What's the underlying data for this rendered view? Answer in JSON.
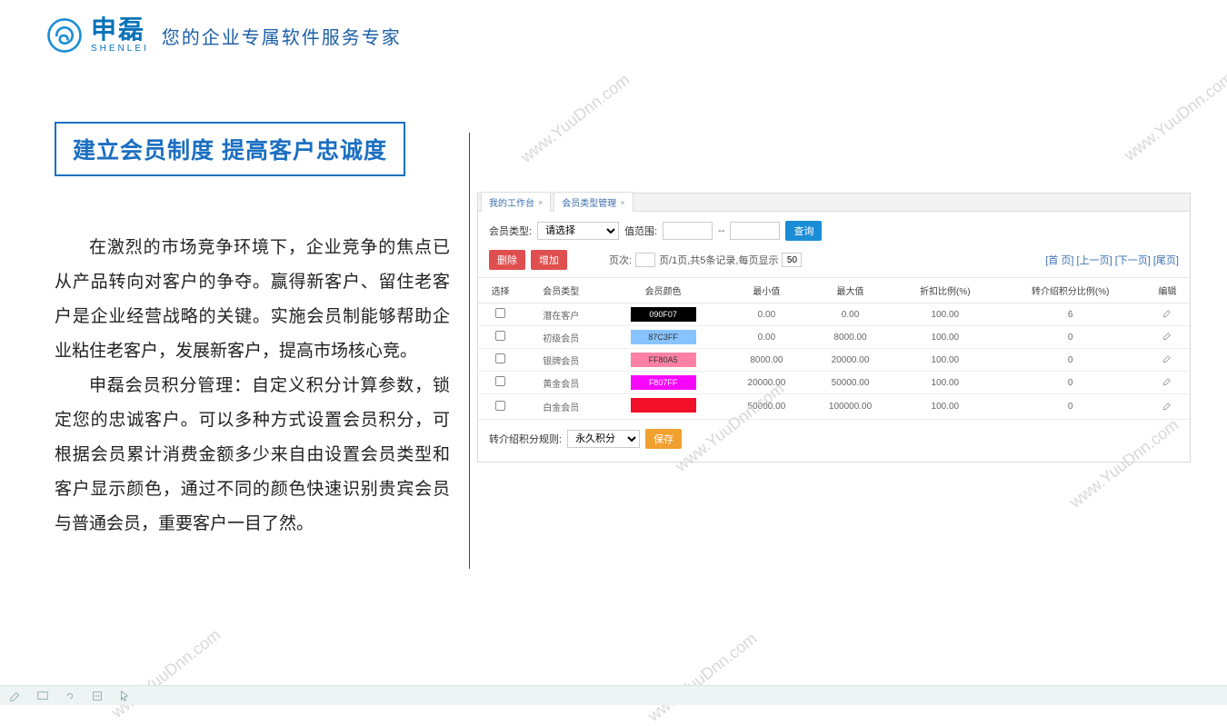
{
  "header": {
    "brand_cn": "申磊",
    "brand_en": "SHENLEI",
    "tagline": "您的企业专属软件服务专家"
  },
  "headline": "建立会员制度 提高客户忠诚度",
  "paragraphs": [
    "在激烈的市场竞争环境下，企业竞争的焦点已从产品转向对客户的争夺。赢得新客户、留住老客户是企业经营战略的关键。实施会员制能够帮助企业粘住老客户，发展新客户，提高市场核心竞。",
    "申磊会员积分管理：自定义积分计算参数，锁定您的忠诚客户。可以多种方式设置会员积分，可根据会员累计消费金额多少来自由设置会员类型和客户显示颜色，通过不同的颜色快速识别贵宾会员与普通会员，重要客户一目了然。"
  ],
  "app": {
    "tabs": [
      {
        "label": "我的工作台"
      },
      {
        "label": "会员类型管理"
      }
    ],
    "filters": {
      "type_label": "会员类型:",
      "type_placeholder": "请选择",
      "range_label": "值范围:",
      "range_sep": "--",
      "query_btn": "查询",
      "delete_btn": "删除",
      "add_btn": "增加"
    },
    "pager": {
      "prefix": "页次:",
      "page_input": "",
      "mid": "页/1页,共5条记录,每页显示",
      "per_page": "50",
      "links": "[首 页] [上一页] [下一页] [尾页]"
    },
    "columns": [
      "选择",
      "会员类型",
      "会员颜色",
      "最小值",
      "最大值",
      "折扣比例(%)",
      "转介绍积分比例(%)",
      "编辑"
    ],
    "rows": [
      {
        "type": "潜在客户",
        "color_code": "090F07",
        "bg": "#000000",
        "fg": "#ffffff",
        "min": "0.00",
        "max": "0.00",
        "discount": "100.00",
        "ratio": "6"
      },
      {
        "type": "初级会员",
        "color_code": "87C3FF",
        "bg": "#87c3ff",
        "fg": "#333333",
        "min": "0.00",
        "max": "8000.00",
        "discount": "100.00",
        "ratio": "0"
      },
      {
        "type": "银牌会员",
        "color_code": "FF80A5",
        "bg": "#ff80a5",
        "fg": "#333333",
        "min": "8000.00",
        "max": "20000.00",
        "discount": "100.00",
        "ratio": "0"
      },
      {
        "type": "黄金会员",
        "color_code": "F807FF",
        "bg": "#f807ff",
        "fg": "#ffffff",
        "min": "20000.00",
        "max": "50000.00",
        "discount": "100.00",
        "ratio": "0"
      },
      {
        "type": "白金会员",
        "color_code": "",
        "bg": "#f20f28",
        "fg": "#ffffff",
        "min": "50000.00",
        "max": "100000.00",
        "discount": "100.00",
        "ratio": "0"
      }
    ],
    "save": {
      "rule_label": "转介绍积分规则:",
      "rule_value": "永久积分",
      "save_btn": "保存"
    }
  },
  "watermark": "www.YuuDnn.com"
}
